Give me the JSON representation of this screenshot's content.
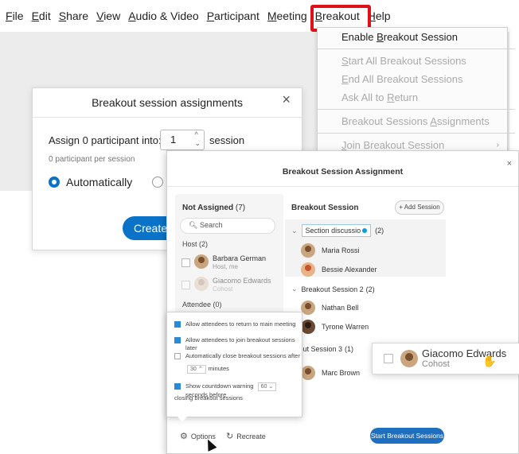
{
  "menu": {
    "items": [
      {
        "pre": "",
        "u": "F",
        "post": "ile"
      },
      {
        "pre": "",
        "u": "E",
        "post": "dit"
      },
      {
        "pre": "",
        "u": "S",
        "post": "hare"
      },
      {
        "pre": "",
        "u": "V",
        "post": "iew"
      },
      {
        "pre": "",
        "u": "A",
        "post": "udio & Video"
      },
      {
        "pre": "",
        "u": "P",
        "post": "articipant"
      },
      {
        "pre": "",
        "u": "M",
        "post": "eeting"
      },
      {
        "pre": "",
        "u": "B",
        "post": "reakout"
      },
      {
        "pre": "",
        "u": "H",
        "post": "elp"
      }
    ],
    "highlighted": "Breakout",
    "highlight_color": "#e0101b"
  },
  "dropdown": {
    "items": [
      {
        "pre": "Enable ",
        "u": "B",
        "post": "reakout Session",
        "enabled": true
      },
      {
        "sep": true
      },
      {
        "pre": "",
        "u": "S",
        "post": "tart All Breakout Sessions",
        "enabled": false
      },
      {
        "pre": "",
        "u": "E",
        "post": "nd All Breakout Sessions",
        "enabled": false
      },
      {
        "pre": "Ask All to ",
        "u": "R",
        "post": "eturn",
        "enabled": false
      },
      {
        "sep": true
      },
      {
        "pre": "Breakout Sessions ",
        "u": "A",
        "post": "ssignments",
        "enabled": false
      },
      {
        "sep": true
      },
      {
        "pre": "",
        "u": "J",
        "post": "oin Breakout Session",
        "enabled": false,
        "submenu": true
      }
    ]
  },
  "old_dialog": {
    "title": "Breakout session assignments",
    "close": "×",
    "assign_label": "Assign 0 participant into:",
    "session_count": "1",
    "session_label": "session",
    "per_session": "0 participant per session",
    "radio_auto": "Automatically",
    "create_label": "Create"
  },
  "window": {
    "title": "Breakout Session Assignment",
    "close": "×",
    "not_assigned": {
      "label": "Not Assigned",
      "count": "(7)"
    },
    "search_placeholder": "Search",
    "host_group": "Host (2)",
    "hosts": [
      {
        "name": "Barbara German",
        "role": "Host, me"
      },
      {
        "name": "Giacomo Edwards",
        "role": "Cohost"
      }
    ],
    "attendee_group": "Attendee (0)",
    "breakout_session_label": "Breakout Session",
    "add_session_label": "Add Session",
    "sessions": [
      {
        "name": "Section discussio",
        "count": "(2)",
        "editing": true,
        "members": [
          "Maria Rossi",
          "Bessie Alexander"
        ]
      },
      {
        "name": "Breakout Session 2",
        "count": "(2)",
        "members": [
          "Nathan Bell",
          "Tyrone Warren"
        ]
      },
      {
        "name": "reakout Session 3",
        "count": "(1)",
        "members": [
          "Marc Brown"
        ]
      }
    ],
    "options_label": "Options",
    "recreate_label": "Recreate",
    "start_label": "Start Breakout Sessions"
  },
  "options_popup": {
    "allow_return": "Allow attendees to return to main meeting",
    "allow_join_later": "Allow attendees to join breakout sessions later",
    "auto_close": "Automatically close breakout sessions after",
    "auto_close_minutes": "30",
    "minutes_label": "minutes",
    "countdown_pre": "Show countdown warning",
    "countdown_value": "60",
    "countdown_post": "seconds before",
    "countdown_line2": "closing breakout sessions",
    "allow_return_checked": true,
    "allow_join_later_checked": true,
    "auto_close_checked": false,
    "countdown_checked": true
  },
  "drag_card": {
    "name": "Giacomo Edwards",
    "role": "Cohost"
  },
  "colors": {
    "accent": "#0a73c8",
    "button": "#1e6fbf"
  }
}
